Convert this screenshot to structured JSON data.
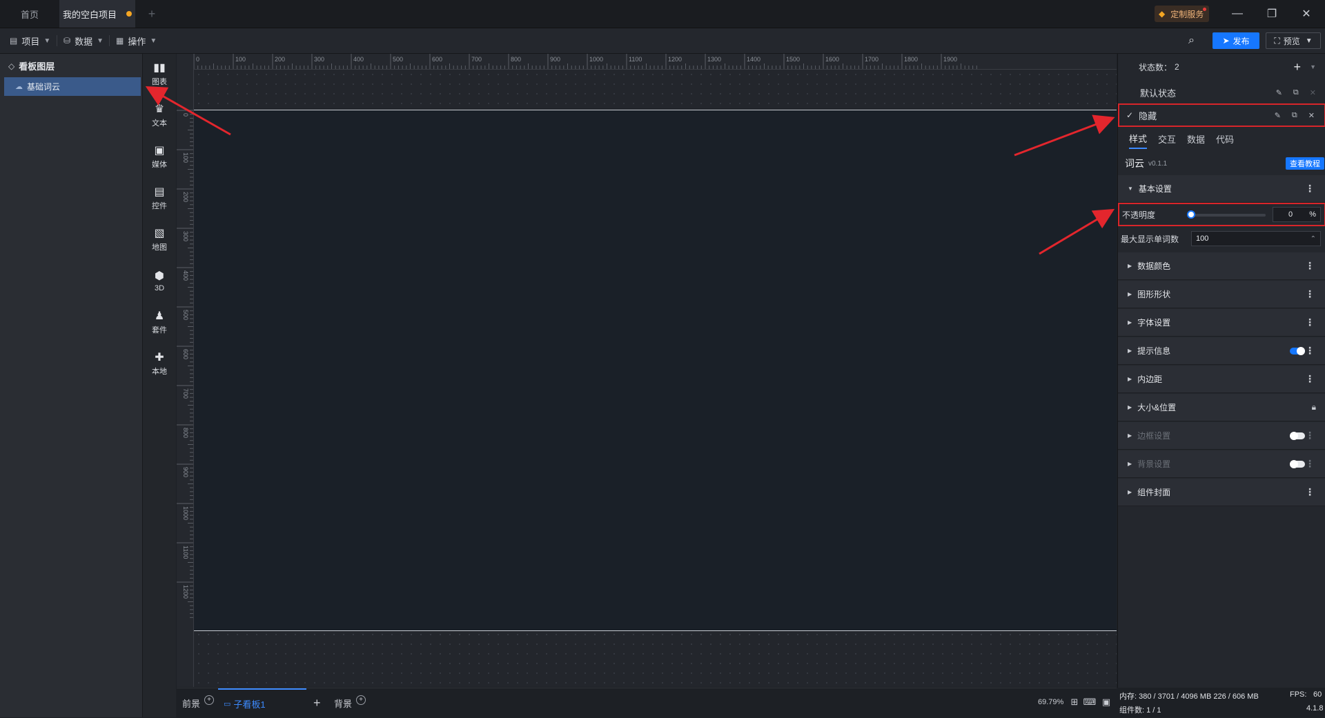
{
  "tabs": [
    {
      "label": "首页"
    },
    {
      "label": "我的空白项目"
    }
  ],
  "vip_label": "定制服务",
  "toolbar": {
    "project": "项目",
    "data": "数据",
    "operate": "操作",
    "publish": "发布",
    "preview": "预览"
  },
  "layers": {
    "title": "看板图层",
    "items": [
      "基础词云"
    ]
  },
  "components": [
    "图表",
    "文本",
    "媒体",
    "控件",
    "地图",
    "3D",
    "套件",
    "本地"
  ],
  "ruler": {
    "top": [
      "0",
      "100",
      "200",
      "300",
      "400",
      "500",
      "600",
      "700",
      "800",
      "900",
      "1000",
      "1100",
      "1200",
      "1300",
      "1400",
      "1500",
      "1600",
      "1700",
      "1800",
      "1900"
    ],
    "left": [
      "0",
      "100",
      "200",
      "300",
      "400",
      "500",
      "600",
      "700",
      "800",
      "900",
      "1000",
      "1100",
      "1200"
    ]
  },
  "bottom": {
    "front": "前景",
    "sub_board": "子看板1",
    "background": "背景",
    "zoom": "69.79%"
  },
  "right": {
    "state_count_label": "状态数：",
    "state_count": "2",
    "states": [
      "默认状态",
      "隐藏"
    ],
    "sub_tabs": [
      "样式",
      "交互",
      "数据",
      "代码"
    ],
    "component_name": "词云",
    "version": "v0.1.1",
    "tutorial": "查看教程",
    "basic_section": "基本设置",
    "opacity_label": "不透明度",
    "opacity_value": "0",
    "opacity_unit": "%",
    "opacity_fraction": 0,
    "max_words_label": "最大显示单词数",
    "max_words_value": "100",
    "sections": [
      "数据颜色",
      "图形形状",
      "字体设置",
      "提示信息",
      "内边距",
      "大小&位置",
      "边框设置",
      "背景设置",
      "组件封面"
    ]
  },
  "status": {
    "memory": "内存:  380 / 3701 / 4096 MB  226 / 606 MB",
    "fps_label": "FPS:",
    "fps": "60",
    "components": "组件数: 1 / 1",
    "version": "4.1.8"
  },
  "colors": {
    "accent": "#1677ff",
    "highlight": "#d9252a",
    "selected_layer": "#3a5a8a"
  }
}
